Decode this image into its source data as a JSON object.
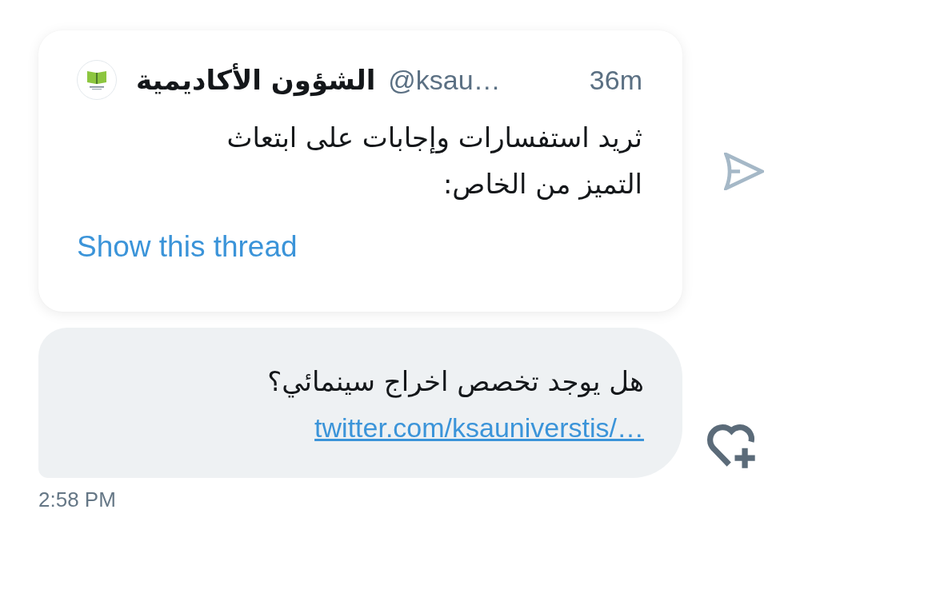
{
  "quoted_tweet": {
    "author_name": "الشؤون الأكاديمية",
    "handle": "@ksau…",
    "time": "36m",
    "text": "ثريد استفسارات وإجابات على ابتعاث التميز من الخاص:",
    "show_thread": "Show this thread"
  },
  "message": {
    "text": "هل يوجد تخصص اخراج سينمائي؟",
    "link": "twitter.com/ksauniverstis/…",
    "timestamp": "2:58 PM"
  }
}
